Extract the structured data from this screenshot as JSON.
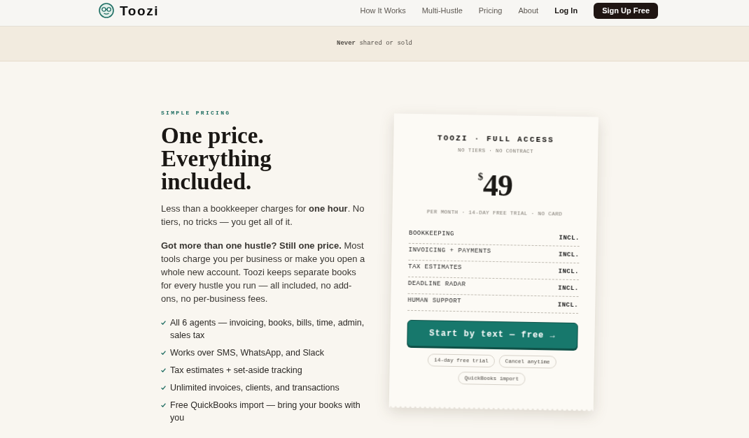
{
  "nav": {
    "brand": "Toozi",
    "links": [
      {
        "label": "How It Works",
        "kind": "link"
      },
      {
        "label": "Multi-Hustle",
        "kind": "link"
      },
      {
        "label": "Pricing",
        "kind": "link"
      },
      {
        "label": "About",
        "kind": "link"
      },
      {
        "label": "Log In",
        "kind": "login"
      }
    ],
    "cta": "Sign Up Free"
  },
  "banner": {
    "text": "**Never** shared or sold"
  },
  "pricing": {
    "eyebrow": "SIMPLE PRICING",
    "headline": "One price. Everything included.",
    "paragraphs": [
      "Less than a bookkeeper charges for **one hour**. No tiers, no tricks — you get all of it.",
      "**Got more than one hustle? Still one price.** Most tools charge you per business or make you open a whole new account. Toozi keeps separate books for every hustle you run — all included, no add-ons, no per-business fees."
    ],
    "features": [
      "All 6 agents — invoicing, books, bills, time, admin, sales tax",
      "Works over SMS, WhatsApp, and Slack",
      "Tax estimates + set-aside tracking",
      "Unlimited invoices, clients, and transactions",
      "Free QuickBooks import — bring your books with you"
    ]
  },
  "receipt": {
    "title": "TOOZI · FULL ACCESS",
    "subtitle": "NO TIERS · NO CONTRACT",
    "currency": "$",
    "amount": "49",
    "terms": "PER MONTH · 14-DAY FREE TRIAL · NO CARD",
    "lines": [
      {
        "item": "BOOKKEEPING",
        "value": "INCL."
      },
      {
        "item": "INVOICING + PAYMENTS",
        "value": "INCL."
      },
      {
        "item": "TAX ESTIMATES",
        "value": "INCL."
      },
      {
        "item": "DEADLINE RADAR",
        "value": "INCL."
      },
      {
        "item": "HUMAN SUPPORT",
        "value": "INCL."
      }
    ],
    "button": "Start by text — free →",
    "chips": [
      "14-day free trial",
      "Cancel anytime",
      "QuickBooks import"
    ]
  }
}
